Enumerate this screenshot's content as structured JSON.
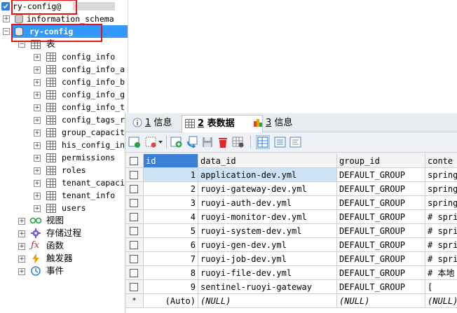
{
  "tree": {
    "connection_label": "ry-config@",
    "databases": [
      {
        "name": "information_schema"
      },
      {
        "name": "ry-config"
      }
    ],
    "tables_folder_label": "表",
    "tables": [
      "config_info",
      "config_info_a",
      "config_info_b",
      "config_info_g",
      "config_info_t",
      "config_tags_r",
      "group_capaciti",
      "his_config_in",
      "permissions",
      "roles",
      "tenant_capaci",
      "tenant_info",
      "users"
    ],
    "folders": [
      {
        "label": "视图",
        "icon": "view-icon"
      },
      {
        "label": "存储过程",
        "icon": "stored-procedure-icon"
      },
      {
        "label": "函数",
        "icon": "function-icon"
      },
      {
        "label": "触发器",
        "icon": "trigger-icon"
      },
      {
        "label": "事件",
        "icon": "event-icon"
      }
    ]
  },
  "tabs": [
    {
      "num": "1",
      "label": "信息",
      "icon": "info-icon",
      "active": false
    },
    {
      "num": "2",
      "label": "表数据",
      "icon": "table-data-icon",
      "active": true
    },
    {
      "num": "3",
      "label": "信息",
      "icon": "info-3-icon",
      "active": false
    }
  ],
  "grid": {
    "columns": [
      "id",
      "data_id",
      "group_id",
      "conte"
    ],
    "rows": [
      {
        "id": "1",
        "data_id": "application-dev.yml",
        "group_id": "DEFAULT_GROUP",
        "content": "spring"
      },
      {
        "id": "2",
        "data_id": "ruoyi-gateway-dev.yml",
        "group_id": "DEFAULT_GROUP",
        "content": "spring"
      },
      {
        "id": "3",
        "data_id": "ruoyi-auth-dev.yml",
        "group_id": "DEFAULT_GROUP",
        "content": "spring"
      },
      {
        "id": "4",
        "data_id": "ruoyi-monitor-dev.yml",
        "group_id": "DEFAULT_GROUP",
        "content": "# spri"
      },
      {
        "id": "5",
        "data_id": "ruoyi-system-dev.yml",
        "group_id": "DEFAULT_GROUP",
        "content": "# spri"
      },
      {
        "id": "6",
        "data_id": "ruoyi-gen-dev.yml",
        "group_id": "DEFAULT_GROUP",
        "content": "# spri"
      },
      {
        "id": "7",
        "data_id": "ruoyi-job-dev.yml",
        "group_id": "DEFAULT_GROUP",
        "content": "# spri"
      },
      {
        "id": "8",
        "data_id": "ruoyi-file-dev.yml",
        "group_id": "DEFAULT_GROUP",
        "content": "# 本地"
      },
      {
        "id": "9",
        "data_id": "sentinel-ruoyi-gateway",
        "group_id": "DEFAULT_GROUP",
        "content": "["
      }
    ],
    "new_row": {
      "marker": "*",
      "id": "(Auto)",
      "data_id": "(NULL)",
      "group_id": "(NULL)",
      "content": "(NULL)"
    }
  },
  "colors": {
    "selection": "#3399ff",
    "highlight_box": "#e2141a",
    "column_selected": "#3b7fd6"
  }
}
